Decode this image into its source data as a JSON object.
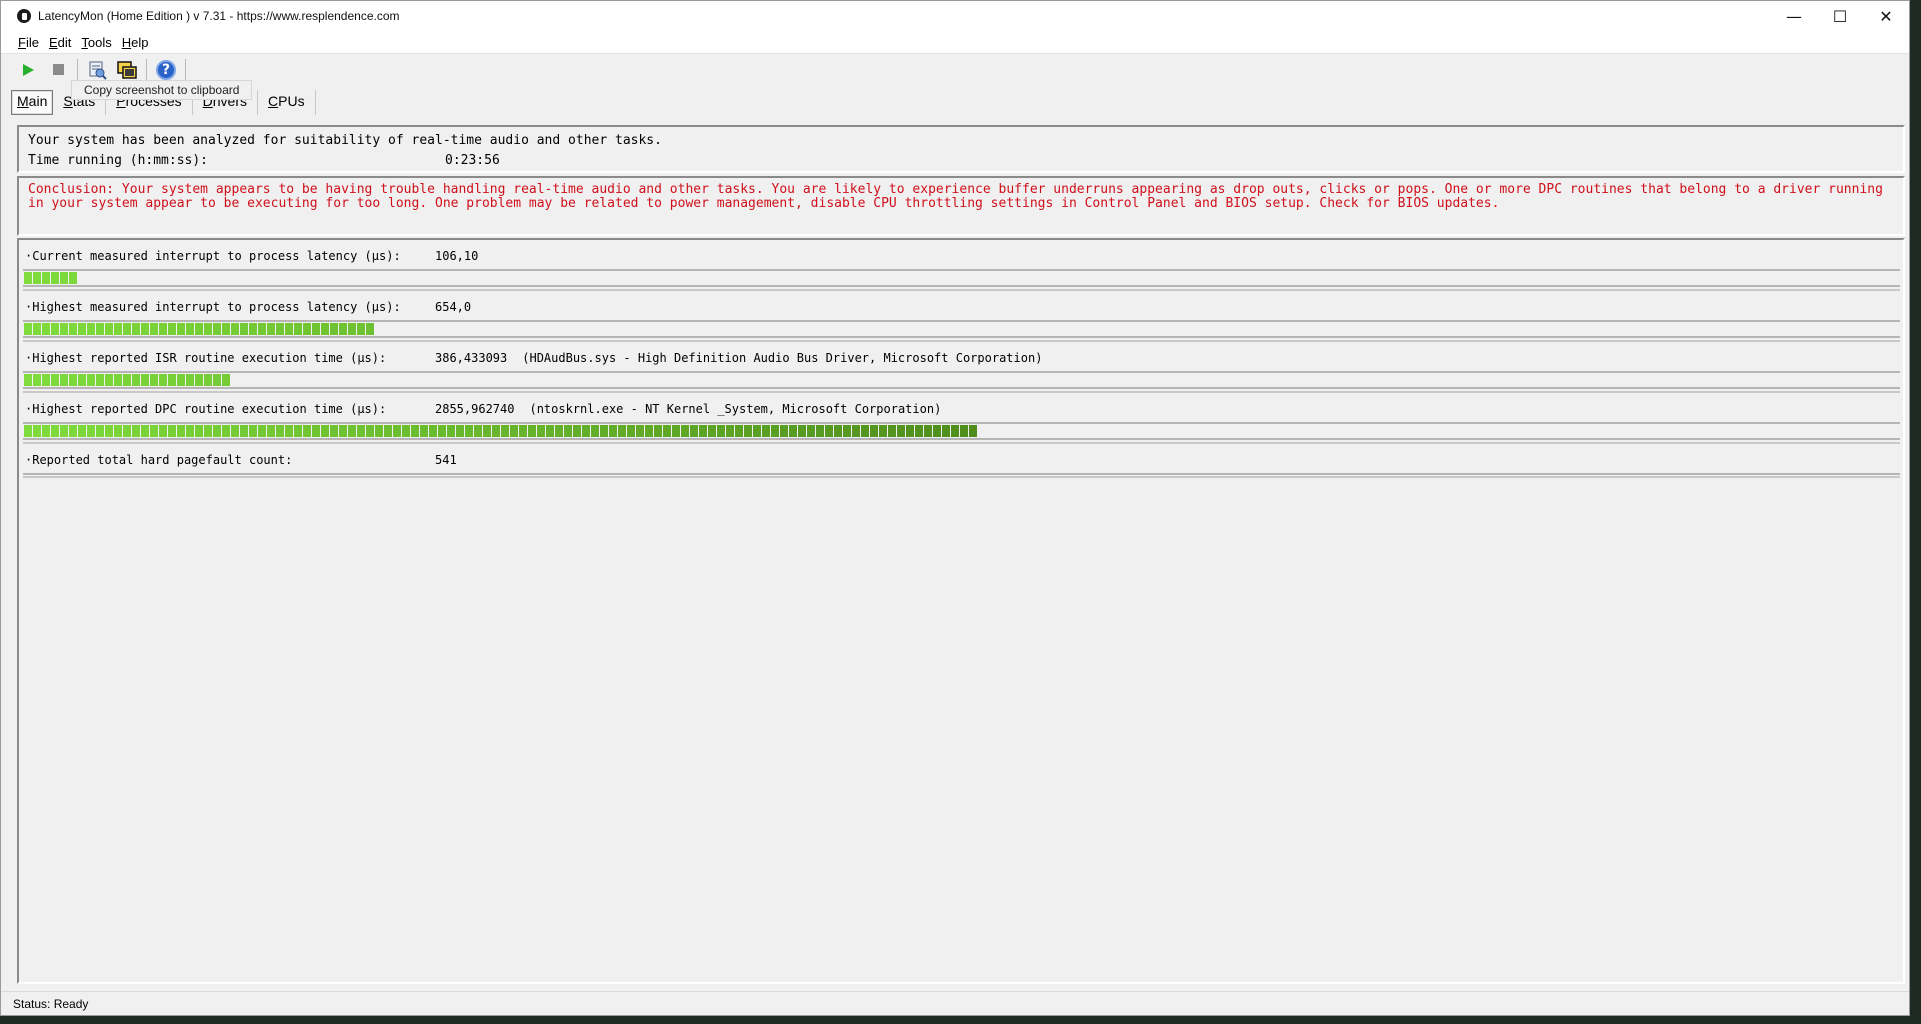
{
  "window": {
    "title": "LatencyMon  (Home Edition )  v 7.31 - https://www.resplendence.com",
    "minimize_glyph": "—",
    "maximize_glyph": "☐",
    "close_glyph": "✕"
  },
  "menu": [
    {
      "first": "F",
      "rest": "ile"
    },
    {
      "first": "E",
      "rest": "dit"
    },
    {
      "first": "T",
      "rest": "ools"
    },
    {
      "first": "H",
      "rest": "elp"
    }
  ],
  "toolbar": {
    "icons": [
      "play-icon",
      "stop-icon",
      "report-icon",
      "screenshot-icon",
      "help-icon"
    ],
    "help_glyph": "?",
    "tooltip": "Copy screenshot to clipboard"
  },
  "tabs": [
    {
      "first": "M",
      "rest": "ain",
      "active": true
    },
    {
      "first": "S",
      "rest": "tats"
    },
    {
      "first": "P",
      "rest": "rocesses"
    },
    {
      "first": "D",
      "rest": "rivers"
    },
    {
      "first": "C",
      "rest": "PUs"
    }
  ],
  "info": {
    "line1": "Your system has been analyzed for suitability of real-time audio and other tasks.",
    "time_label": "Time running (h:mm:ss):",
    "time_value": "0:23:56"
  },
  "conclusion": "Conclusion: Your system appears to be having trouble handling real-time audio and other tasks. You are likely to experience buffer underruns appearing as drop outs, clicks or pops. One or more DPC routines that belong to a driver running in your system appear to be executing for too long. One problem may be related to power management, disable CPU throttling settings in Control Panel and BIOS setup. Check for BIOS updates.",
  "metrics": [
    {
      "label": "·Current measured interrupt to process latency (µs):",
      "value": "106,10",
      "detail": "",
      "bar_fraction": 0.027
    },
    {
      "label": "·Highest measured interrupt to process latency (µs):",
      "value": "654,0",
      "detail": "",
      "bar_fraction": 0.186
    },
    {
      "label": "·Highest reported ISR routine execution time (µs):",
      "value": "386,433093",
      "detail": "(HDAudBus.sys - High Definition Audio Bus Driver, Microsoft Corporation)",
      "bar_fraction": 0.109
    },
    {
      "label": "·Highest reported DPC routine execution time (µs):",
      "value": "2855,962740",
      "detail": "(ntoskrnl.exe - NT Kernel _System, Microsoft Corporation)",
      "bar_fraction": 0.507
    }
  ],
  "pagefault": {
    "label": "·Reported total hard pagefault count:",
    "value": "541"
  },
  "colors": {
    "bar_green": "#7fdc3c",
    "bar_dark_green": "#4f8f1d",
    "bar_brown": "#7a3a10",
    "conclusion_red": "#d0101b"
  },
  "status": "Status: Ready"
}
